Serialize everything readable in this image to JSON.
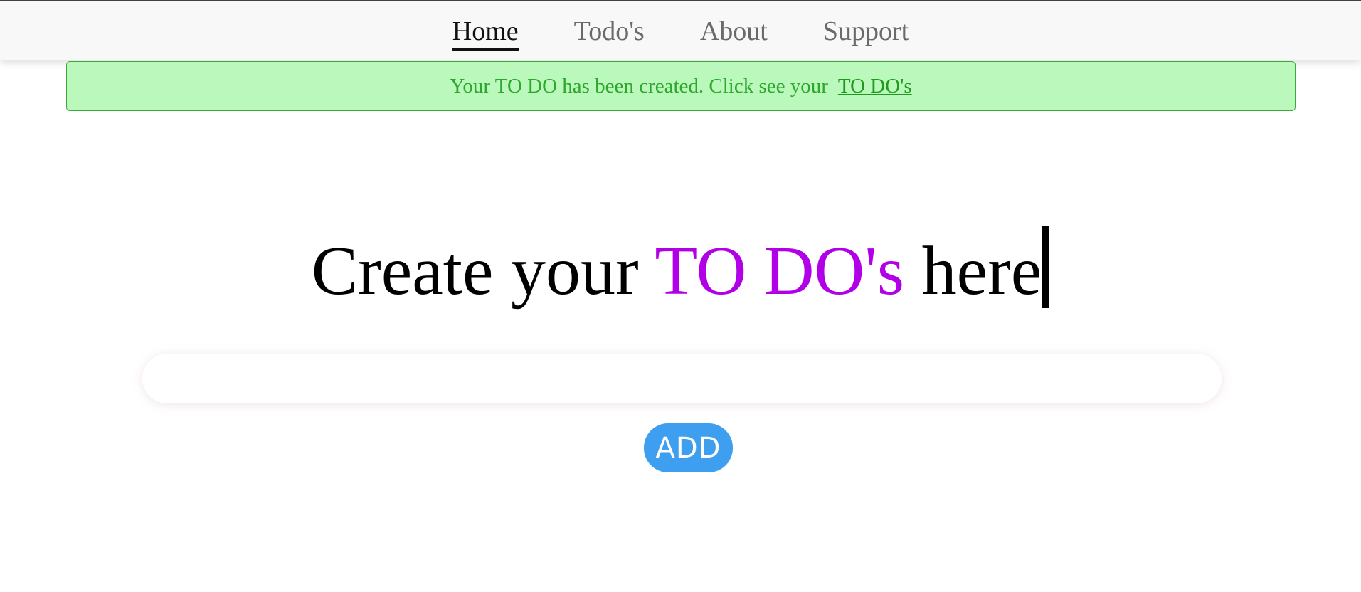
{
  "nav": {
    "items": [
      {
        "label": "Home",
        "active": true
      },
      {
        "label": "Todo's",
        "active": false
      },
      {
        "label": "About",
        "active": false
      },
      {
        "label": "Support",
        "active": false
      }
    ]
  },
  "alert": {
    "message": "Your TO DO has been created. Click see your",
    "link_label": "TO DO's",
    "background_color": "#bbf8bb",
    "text_color": "#2ca82c"
  },
  "headline": {
    "prefix": "Create your",
    "accent": "TO DO's",
    "suffix": "here",
    "accent_color": "#b100e8"
  },
  "todo_input": {
    "value": "",
    "placeholder": ""
  },
  "add_button": {
    "label": "ADD",
    "color": "#3e9ef0"
  }
}
